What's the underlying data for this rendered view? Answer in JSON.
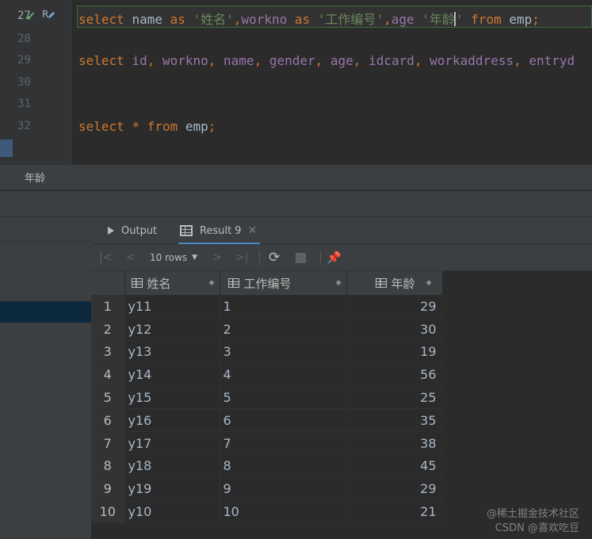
{
  "editor": {
    "line_numbers": [
      "27",
      "28",
      "29",
      "30",
      "31",
      "32"
    ],
    "gutter_run_label": "R",
    "lines": [
      [
        {
          "t": "select",
          "c": "kw"
        },
        {
          "t": " ",
          "c": "plain"
        },
        {
          "t": "name",
          "c": "plain"
        },
        {
          "t": " ",
          "c": "plain"
        },
        {
          "t": "as",
          "c": "kw"
        },
        {
          "t": " ",
          "c": "plain"
        },
        {
          "t": "'姓名'",
          "c": "str"
        },
        {
          "t": ",",
          "c": "kw"
        },
        {
          "t": "workno",
          "c": "ident"
        },
        {
          "t": " ",
          "c": "plain"
        },
        {
          "t": "as",
          "c": "kw"
        },
        {
          "t": " ",
          "c": "plain"
        },
        {
          "t": "'工作编号'",
          "c": "str"
        },
        {
          "t": ",",
          "c": "kw"
        },
        {
          "t": "age",
          "c": "ident"
        },
        {
          "t": " ",
          "c": "plain"
        },
        {
          "t": "'年龄",
          "c": "str"
        },
        {
          "t": "CARET",
          "c": "caret"
        },
        {
          "t": "'",
          "c": "str"
        },
        {
          "t": " ",
          "c": "plain"
        },
        {
          "t": "from",
          "c": "kw"
        },
        {
          "t": " ",
          "c": "plain"
        },
        {
          "t": "emp",
          "c": "plain"
        },
        {
          "t": ";",
          "c": "kw"
        }
      ],
      [
        {
          "t": "select",
          "c": "kw"
        },
        {
          "t": " ",
          "c": "plain"
        },
        {
          "t": "id",
          "c": "ident"
        },
        {
          "t": ", ",
          "c": "kw"
        },
        {
          "t": "workno",
          "c": "ident"
        },
        {
          "t": ", ",
          "c": "kw"
        },
        {
          "t": "name",
          "c": "ident"
        },
        {
          "t": ", ",
          "c": "kw"
        },
        {
          "t": "gender",
          "c": "ident"
        },
        {
          "t": ", ",
          "c": "kw"
        },
        {
          "t": "age",
          "c": "ident"
        },
        {
          "t": ", ",
          "c": "kw"
        },
        {
          "t": "idcard",
          "c": "ident"
        },
        {
          "t": ", ",
          "c": "kw"
        },
        {
          "t": "workaddress",
          "c": "ident"
        },
        {
          "t": ", ",
          "c": "kw"
        },
        {
          "t": "entryd",
          "c": "ident"
        }
      ],
      [
        {
          "t": "select",
          "c": "kw"
        },
        {
          "t": " ",
          "c": "plain"
        },
        {
          "t": "*",
          "c": "kw"
        },
        {
          "t": " ",
          "c": "plain"
        },
        {
          "t": "from",
          "c": "kw"
        },
        {
          "t": " ",
          "c": "plain"
        },
        {
          "t": "emp",
          "c": "plain"
        },
        {
          "t": ";",
          "c": "kw"
        }
      ]
    ]
  },
  "breadcrumb": "年龄",
  "tabs": {
    "output_label": "Output",
    "result_label": "Result 9"
  },
  "toolbar": {
    "rows_label": "10 rows"
  },
  "grid": {
    "columns": [
      "姓名",
      "工作编号",
      "年龄"
    ],
    "rows": [
      [
        "1",
        "y11",
        "1",
        "29"
      ],
      [
        "2",
        "y12",
        "2",
        "30"
      ],
      [
        "3",
        "y13",
        "3",
        "19"
      ],
      [
        "4",
        "y14",
        "4",
        "56"
      ],
      [
        "5",
        "y15",
        "5",
        "25"
      ],
      [
        "6",
        "y16",
        "6",
        "35"
      ],
      [
        "7",
        "y17",
        "7",
        "38"
      ],
      [
        "8",
        "y18",
        "8",
        "45"
      ],
      [
        "9",
        "y19",
        "9",
        "29"
      ],
      [
        "10",
        "y10",
        "10",
        "21"
      ]
    ]
  },
  "watermark": {
    "top": "@稀土掘金技术社区",
    "bottom": "CSDN @喜欢吃豆"
  },
  "colors": {
    "keyword": "#cc7832",
    "identifier": "#9876aa",
    "string": "#6a8759",
    "text": "#a9b7c6",
    "background": "#2b2b2b",
    "accent": "#4a88c7"
  }
}
